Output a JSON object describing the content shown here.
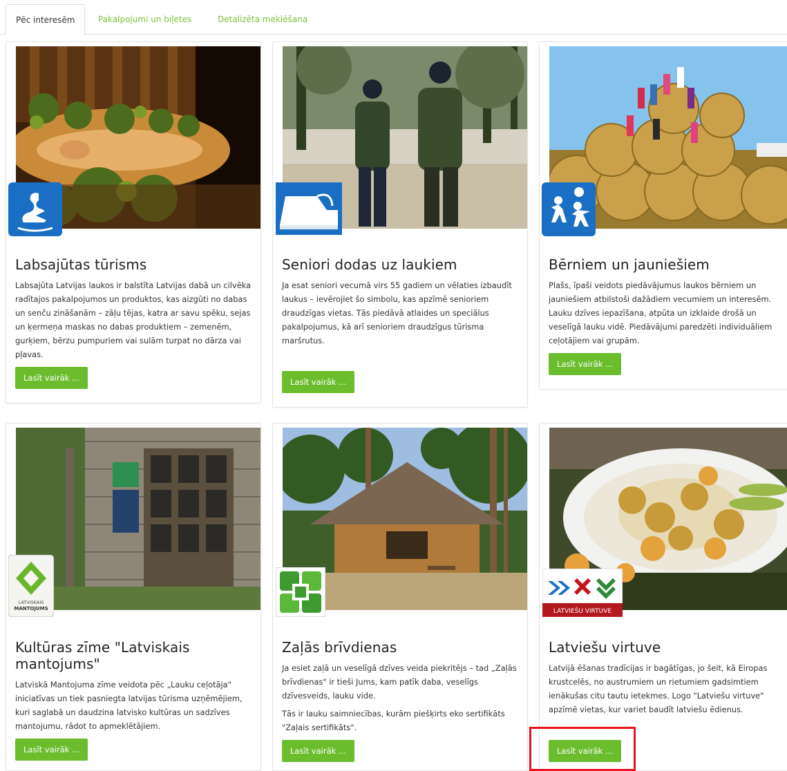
{
  "tabs": [
    {
      "label": "Pēc interesēm"
    },
    {
      "label": "Pakalpojumi un biļetes"
    },
    {
      "label": "Detalizēta meklēšana"
    }
  ],
  "cards": [
    {
      "title": "Labsajūtas tūrisms",
      "desc": "Labsajūta Latvijas laukos ir balstīta Latvijas dabā un cilvēka radītajos pakalpojumos un produktos, kas aizgūti no dabas un senču zināšanām – zāļu tējas, katra ar savu spēku, sejas un ķermeņa maskas no dabas produktiem – zemenēm, gurķiem, bērzu pumpuriem vai sulām turpat no dārza vai pļavas.",
      "button": "Lasīt vairāk ..."
    },
    {
      "title": "Seniori dodas uz laukiem",
      "desc": "Ja esat seniori vecumā virs 55 gadiem un vēlaties izbaudīt laukus – ievērojiet šo simbolu, kas apzīmē senioriem draudzīgas vietas. Tās piedāvā atlaides un speciālus pakalpojumus, kā arī senioriem draudzīgus tūrisma maršrutus.",
      "button": "Lasīt vairāk ..."
    },
    {
      "title": "Bērniem un jauniešiem",
      "desc": "Plašs, īpaši veidots piedāvājumus laukos bērniem un jauniešiem atbilstoši dažādiem vecumiem un interesēm. Lauku dzīves iepazīšana, atpūta un izklaide drošā un veselīgā lauku vidē. Piedāvājumi paredzēti individuāliem ceļotājiem vai grupām.",
      "button": "Lasīt vairāk ..."
    },
    {
      "title": "Kultūras zīme \"Latviskais mantojums\"",
      "desc": "Latviskā Mantojuma zīme veidota pēc „Lauku ceļotāja\" iniciatīvas un tiek pasniegta latvijas tūrisma uzņēmējiem, kuri saglabā un daudzina latvisko kultūras un sadzīves mantojumu, rādot to apmeklētājiem.",
      "button": "Lasīt vairāk ..."
    },
    {
      "title": "Zaļās brīvdienas",
      "desc": "Ja esiet zaļā un veselīgā dzīves veida piekritējs – tad „Zaļās brīvdienas\" ir tieši Jums, kam patīk daba, veselīgs dzīvesveids, lauku vide.",
      "desc2": "Tās ir lauku saimniecības, kurām piešķirts eko sertifikāts \"Zaļais sertifikāts\".",
      "button": "Lasīt vairāk ..."
    },
    {
      "title": "Latviešu virtuve",
      "desc": "Latvijā ēšanas tradīcijas ir bagātīgas, jo šeit, kā Eiropas krustcelēs, no austrumiem un rietumiem gadsimtiem ienākušas citu tautu ietekmes. Logo \"Latviešu virtuve\" apzīmē vietas, kur variet baudīt latviešu ēdienus.",
      "button": "Lasīt vairāk ..."
    }
  ],
  "badges": {
    "mantojums_text_1": "LATVISKAIS",
    "mantojums_text_2": "MANTOJUMS",
    "virtuve_label": "LATVIEŠU VIRTUVE"
  },
  "colors": {
    "accent_green": "#6bbd2e",
    "tab_text_green": "#7cc23a",
    "highlight_red": "#e8121a",
    "badge_blue": "#1a6fc4"
  }
}
